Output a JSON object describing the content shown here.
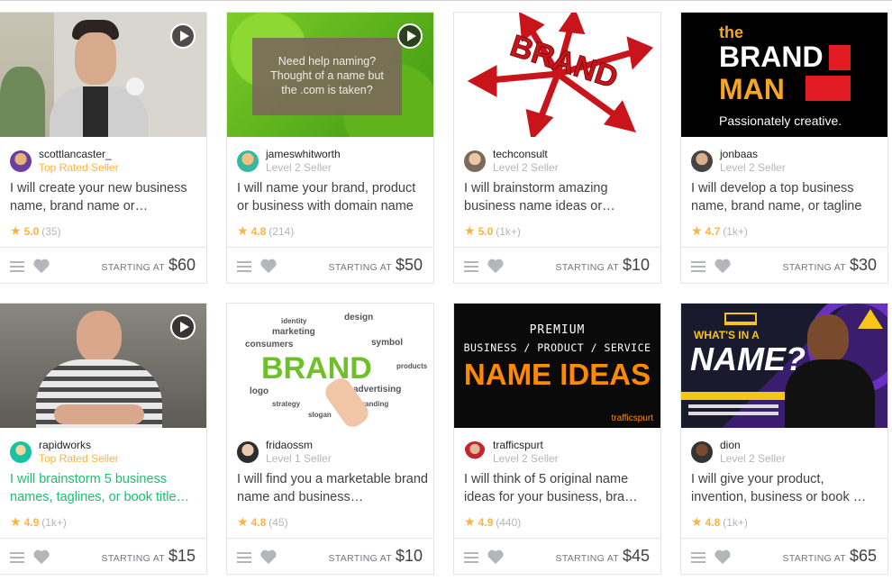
{
  "labels": {
    "starting_at": "STARTING AT"
  },
  "colors": {
    "star": "#ffb33e",
    "top_rated": "#ffb33e",
    "link_green": "#1dbf73",
    "muted": "#b5b6ba"
  },
  "cards": [
    {
      "seller": "scottlancaster_",
      "level": "Top Rated Seller",
      "title": "I will create your new business name, brand name or…",
      "rating": "5.0",
      "reviews": "(35)",
      "price": "$60",
      "thumb": {
        "type": "video",
        "icon": "play-icon"
      }
    },
    {
      "seller": "jameswhitworth",
      "level": "Level 2 Seller",
      "title": "I will name your brand, product or business with domain name",
      "rating": "4.8",
      "reviews": "(214)",
      "price": "$50",
      "thumb": {
        "type": "video",
        "icon": "play-icon",
        "text": [
          "Need help naming?",
          "Thought of a name but",
          "the .com is taken?"
        ]
      }
    },
    {
      "seller": "techconsult",
      "level": "Level 2 Seller",
      "title": "I will brainstorm amazing business name ideas or…",
      "rating": "5.0",
      "reviews": "(1k+)",
      "price": "$10",
      "thumb": {
        "type": "image",
        "text": [
          "BRAND"
        ]
      }
    },
    {
      "seller": "jonbaas",
      "level": "Level 2 Seller",
      "title": "I will develop a top business name, brand name, or tagline",
      "rating": "4.7",
      "reviews": "(1k+)",
      "price": "$30",
      "thumb": {
        "type": "image",
        "text": [
          "the",
          "BRAND",
          "MAN",
          "Passionately creative."
        ]
      }
    },
    {
      "seller": "rapidworks",
      "level": "Top Rated Seller",
      "title": "I will brainstorm 5 business names, taglines, or book title…",
      "rating": "4.9",
      "reviews": "(1k+)",
      "price": "$15",
      "thumb": {
        "type": "video",
        "icon": "play-icon"
      }
    },
    {
      "seller": "fridaossm",
      "level": "Level 1 Seller",
      "title": "I will find you a marketable brand name and business…",
      "rating": "4.8",
      "reviews": "(45)",
      "price": "$10",
      "thumb": {
        "type": "image",
        "text": [
          "BRAND",
          "identity",
          "marketing",
          "consumers",
          "symbol",
          "strategy",
          "design",
          "logo",
          "products",
          "slogan",
          "advertising",
          "branding"
        ]
      }
    },
    {
      "seller": "trafficspurt",
      "level": "Level 2 Seller",
      "title": "I will think of 5 original name ideas for your business, bra…",
      "rating": "4.9",
      "reviews": "(440)",
      "price": "$45",
      "thumb": {
        "type": "image",
        "text": [
          "PREMIUM",
          "BUSINESS / PRODUCT / SERVICE",
          "NAME IDEAS",
          "trafficspurt"
        ]
      }
    },
    {
      "seller": "dion",
      "level": "Level 2 Seller",
      "title": "I will give your product, invention, business or book …",
      "rating": "4.8",
      "reviews": "(1k+)",
      "price": "$65",
      "thumb": {
        "type": "image",
        "text": [
          "WHAT'S IN A",
          "NAME?"
        ]
      }
    }
  ]
}
